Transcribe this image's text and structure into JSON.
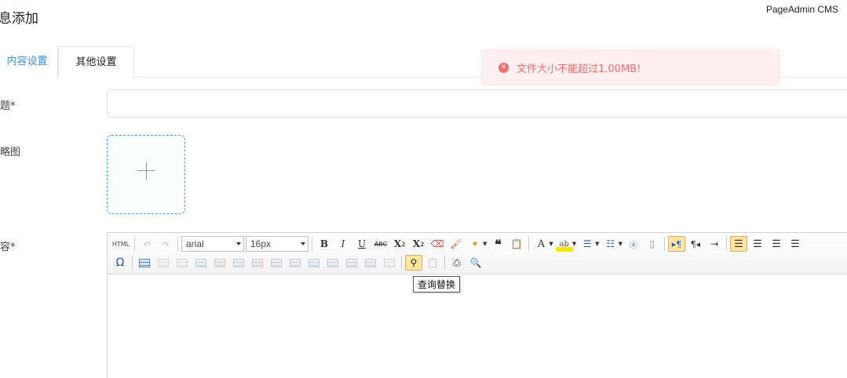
{
  "page": {
    "title": "息添加",
    "brand": "PageAdmin CMS"
  },
  "tabs": [
    {
      "label": "内容设置"
    },
    {
      "label": "其他设置"
    }
  ],
  "alert": {
    "icon": "error-circle-icon",
    "message": "文件大小不能超过1.00MB!",
    "color": "#f56c6c"
  },
  "form": {
    "title_label": "题*",
    "title_value": "",
    "thumb_label": "略图",
    "content_label": "容*"
  },
  "editor": {
    "font_family": "arial",
    "font_size": "16px",
    "tooltip": "查询替换",
    "toolbar_row1": [
      "html-source",
      "undo",
      "redo",
      "font-family",
      "font-size",
      "bold",
      "italic",
      "underline",
      "strikethrough",
      "superscript",
      "subscript",
      "eraser",
      "format-brush",
      "auto-format",
      "blockquote",
      "paste-text",
      "font-color",
      "highlight",
      "ordered-list",
      "unordered-list",
      "select-all",
      "clear-doc",
      "ltr",
      "rtl",
      "indent",
      "align-left",
      "align-center",
      "align-right",
      "justify"
    ],
    "toolbar_row2": [
      "special-char",
      "insert-table",
      "delete-table",
      "insert-paragraph-before",
      "insert-row",
      "delete-row",
      "insert-col",
      "delete-col",
      "merge-cells",
      "merge-right",
      "merge-down",
      "split-cells",
      "split-rows",
      "split-cols",
      "table-props",
      "search-replace",
      "paste",
      "print",
      "preview"
    ]
  }
}
